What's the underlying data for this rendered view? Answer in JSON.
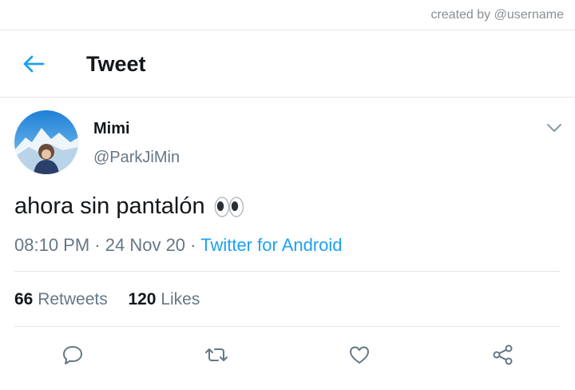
{
  "watermark": "created by @username",
  "header": {
    "title": "Tweet",
    "back_icon": "arrow-left-icon"
  },
  "tweet": {
    "author": {
      "display_name": "Mimi",
      "handle": "@ParkJiMin"
    },
    "text": "ahora sin pantalón",
    "emoji": "eyes-emoji",
    "time": "08:10 PM",
    "date": "24 Nov 20",
    "separator": "·",
    "source": "Twitter for Android"
  },
  "stats": {
    "retweets_count": "66",
    "retweets_label": "Retweets",
    "likes_count": "120",
    "likes_label": "Likes"
  },
  "actions": [
    "reply-icon",
    "retweet-icon",
    "like-icon",
    "share-icon"
  ],
  "colors": {
    "accent": "#1da1f2",
    "secondary_text": "#657786",
    "action_icon": "#657786",
    "divider": "#e1e6ea"
  }
}
